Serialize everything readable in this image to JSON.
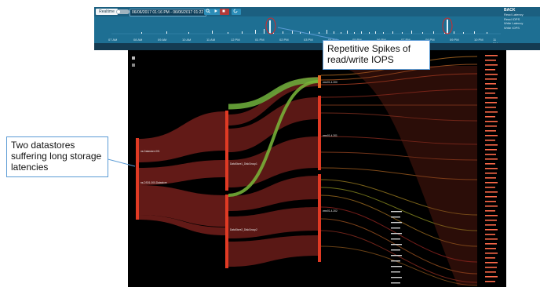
{
  "toolbar": {
    "realtime_label": "Realtime",
    "toggle_label": "OFF",
    "range_label": "06/06/2017 01:16 PM - 06/06/2017 01:22 PM",
    "range_arrow": "▾"
  },
  "timeline_legend": {
    "title": "BACK",
    "items": [
      "Read Latency",
      "Read IOPS",
      "Write Latency",
      "Write IOPS"
    ]
  },
  "timeline_axis": [
    "07 AM",
    "08 AM",
    "09 AM",
    "10 AM",
    "11 AM",
    "12 PM",
    "01 PM",
    "02 PM",
    "03 PM",
    "04 PM",
    "05 PM",
    "06 PM",
    "07 PM",
    "08 PM",
    "09 PM",
    "10 PM",
    "11 PM"
  ],
  "datastores": [
    "ns-Datastore-001",
    "ns-DS01-000-Datastore"
  ],
  "middle_nodes": [
    "DataStore1_DiskGroup1",
    "DataStore2_DiskGroup2"
  ],
  "right_nodes": [
    "vmn01-4-200",
    "vmn01-4-201",
    "vmn01-4-202"
  ],
  "callouts": {
    "left": "Two datastores suffering long storage latencies",
    "right": "Repetitive Spikes of read/write IOPS"
  },
  "colors": {
    "timeline_bg": "#1e6f93",
    "canvas_bg": "#000000",
    "flow_red": "#c0392b",
    "flow_green": "#7ab83a",
    "callout_border": "#5b9bd5",
    "highlight_circle": "#d62828"
  }
}
